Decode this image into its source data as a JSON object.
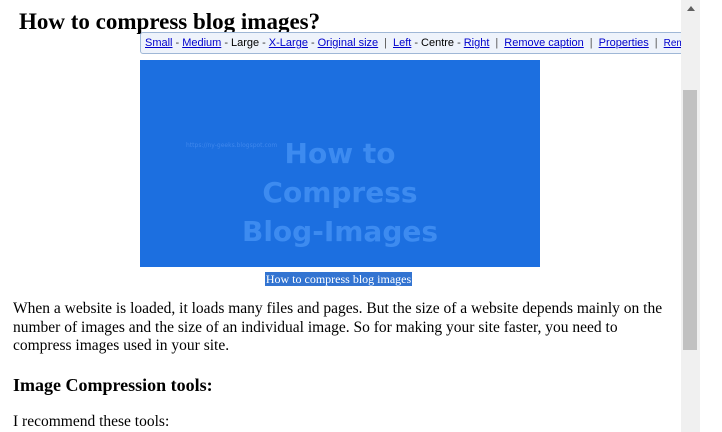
{
  "post": {
    "title": "How to compress blog images?",
    "paragraph": "When a website is loaded, it loads many files and pages. But the size of a website depends mainly on the number of images and the size of an individual image. So for making your site faster, you need to compress images used in your site.",
    "heading2": "Image Compression tools:",
    "paragraph2": "I recommend these tools:"
  },
  "toolbar": {
    "small": "Small",
    "medium": "Medium",
    "large": "Large",
    "xlarge": "X-Large",
    "original": "Original size",
    "left": "Left",
    "centre": "Centre",
    "right": "Right",
    "remove_caption": "Remove caption",
    "properties": "Properties",
    "remove": "Remove",
    "dash": "-",
    "bar": "|",
    "close_icon": "close-icon"
  },
  "image": {
    "line1": "How to",
    "line2": "Compress",
    "line3": "Blog-Images",
    "url": "https://ny-geeks.blogspot.com",
    "background": "#1c6fe0"
  },
  "caption": "How to compress blog images",
  "colors": {
    "link": "#0000cc",
    "caption_highlight": "#3374d1",
    "toolbar_bg": "#eef3fb",
    "scroll_thumb": "#c1c1c1"
  }
}
